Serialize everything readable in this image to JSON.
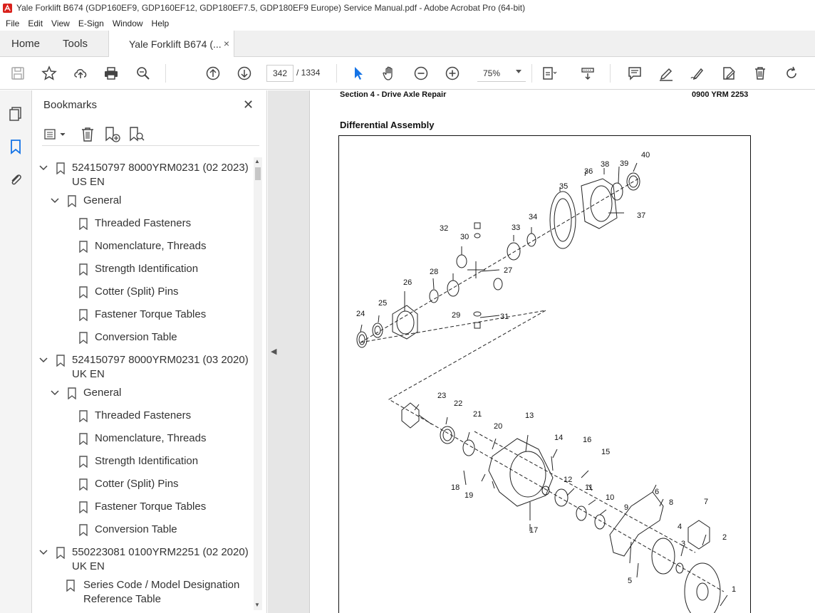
{
  "window": {
    "title": "Yale Forklift B674 (GDP160EF9, GDP160EF12, GDP180EF7.5, GDP180EF9 Europe) Service Manual.pdf - Adobe Acrobat Pro (64-bit)"
  },
  "menu": [
    "File",
    "Edit",
    "View",
    "E-Sign",
    "Window",
    "Help"
  ],
  "tabs": {
    "home": "Home",
    "tools": "Tools",
    "document": "Yale Forklift B674 (...",
    "close": "×"
  },
  "toolbar": {
    "current_page": "342",
    "total_pages": "/ 1334",
    "zoom": "75%"
  },
  "bookmarks": {
    "title": "Bookmarks",
    "close": "✕",
    "items": [
      {
        "label": "524150797 8000YRM0231 (02 2023) US EN",
        "level": 0,
        "expanded": true
      },
      {
        "label": "General",
        "level": 1,
        "expanded": true
      },
      {
        "label": "Threaded Fasteners",
        "level": 2
      },
      {
        "label": "Nomenclature, Threads",
        "level": 2
      },
      {
        "label": "Strength Identification",
        "level": 2
      },
      {
        "label": "Cotter (Split) Pins",
        "level": 2
      },
      {
        "label": "Fastener Torque Tables",
        "level": 2
      },
      {
        "label": "Conversion Table",
        "level": 2
      },
      {
        "label": "524150797 8000YRM0231 (03 2020) UK EN",
        "level": 0,
        "expanded": true
      },
      {
        "label": "General",
        "level": 1,
        "expanded": true
      },
      {
        "label": "Threaded Fasteners",
        "level": 2
      },
      {
        "label": "Nomenclature, Threads",
        "level": 2
      },
      {
        "label": "Strength Identification",
        "level": 2
      },
      {
        "label": "Cotter (Split) Pins",
        "level": 2
      },
      {
        "label": "Fastener Torque Tables",
        "level": 2
      },
      {
        "label": "Conversion Table",
        "level": 2
      },
      {
        "label": "550223081 0100YRM2251 (02 2020) UK EN",
        "level": 0,
        "expanded": true
      },
      {
        "label": "Series Code / Model Designation Reference Table",
        "level": 1
      }
    ]
  },
  "document": {
    "header_left": "Section 4 - Drive Axle Repair",
    "header_right": "0900 YRM 2253",
    "figure_title": "Differential Assembly",
    "callouts": [
      "1",
      "2",
      "3",
      "4",
      "5",
      "6",
      "7",
      "8",
      "9",
      "10",
      "11",
      "12",
      "13",
      "14",
      "15",
      "16",
      "17",
      "18",
      "19",
      "20",
      "21",
      "22",
      "23",
      "24",
      "25",
      "26",
      "27",
      "28",
      "29",
      "30",
      "31",
      "32",
      "33",
      "34",
      "35",
      "36",
      "37",
      "38",
      "39",
      "40"
    ]
  }
}
